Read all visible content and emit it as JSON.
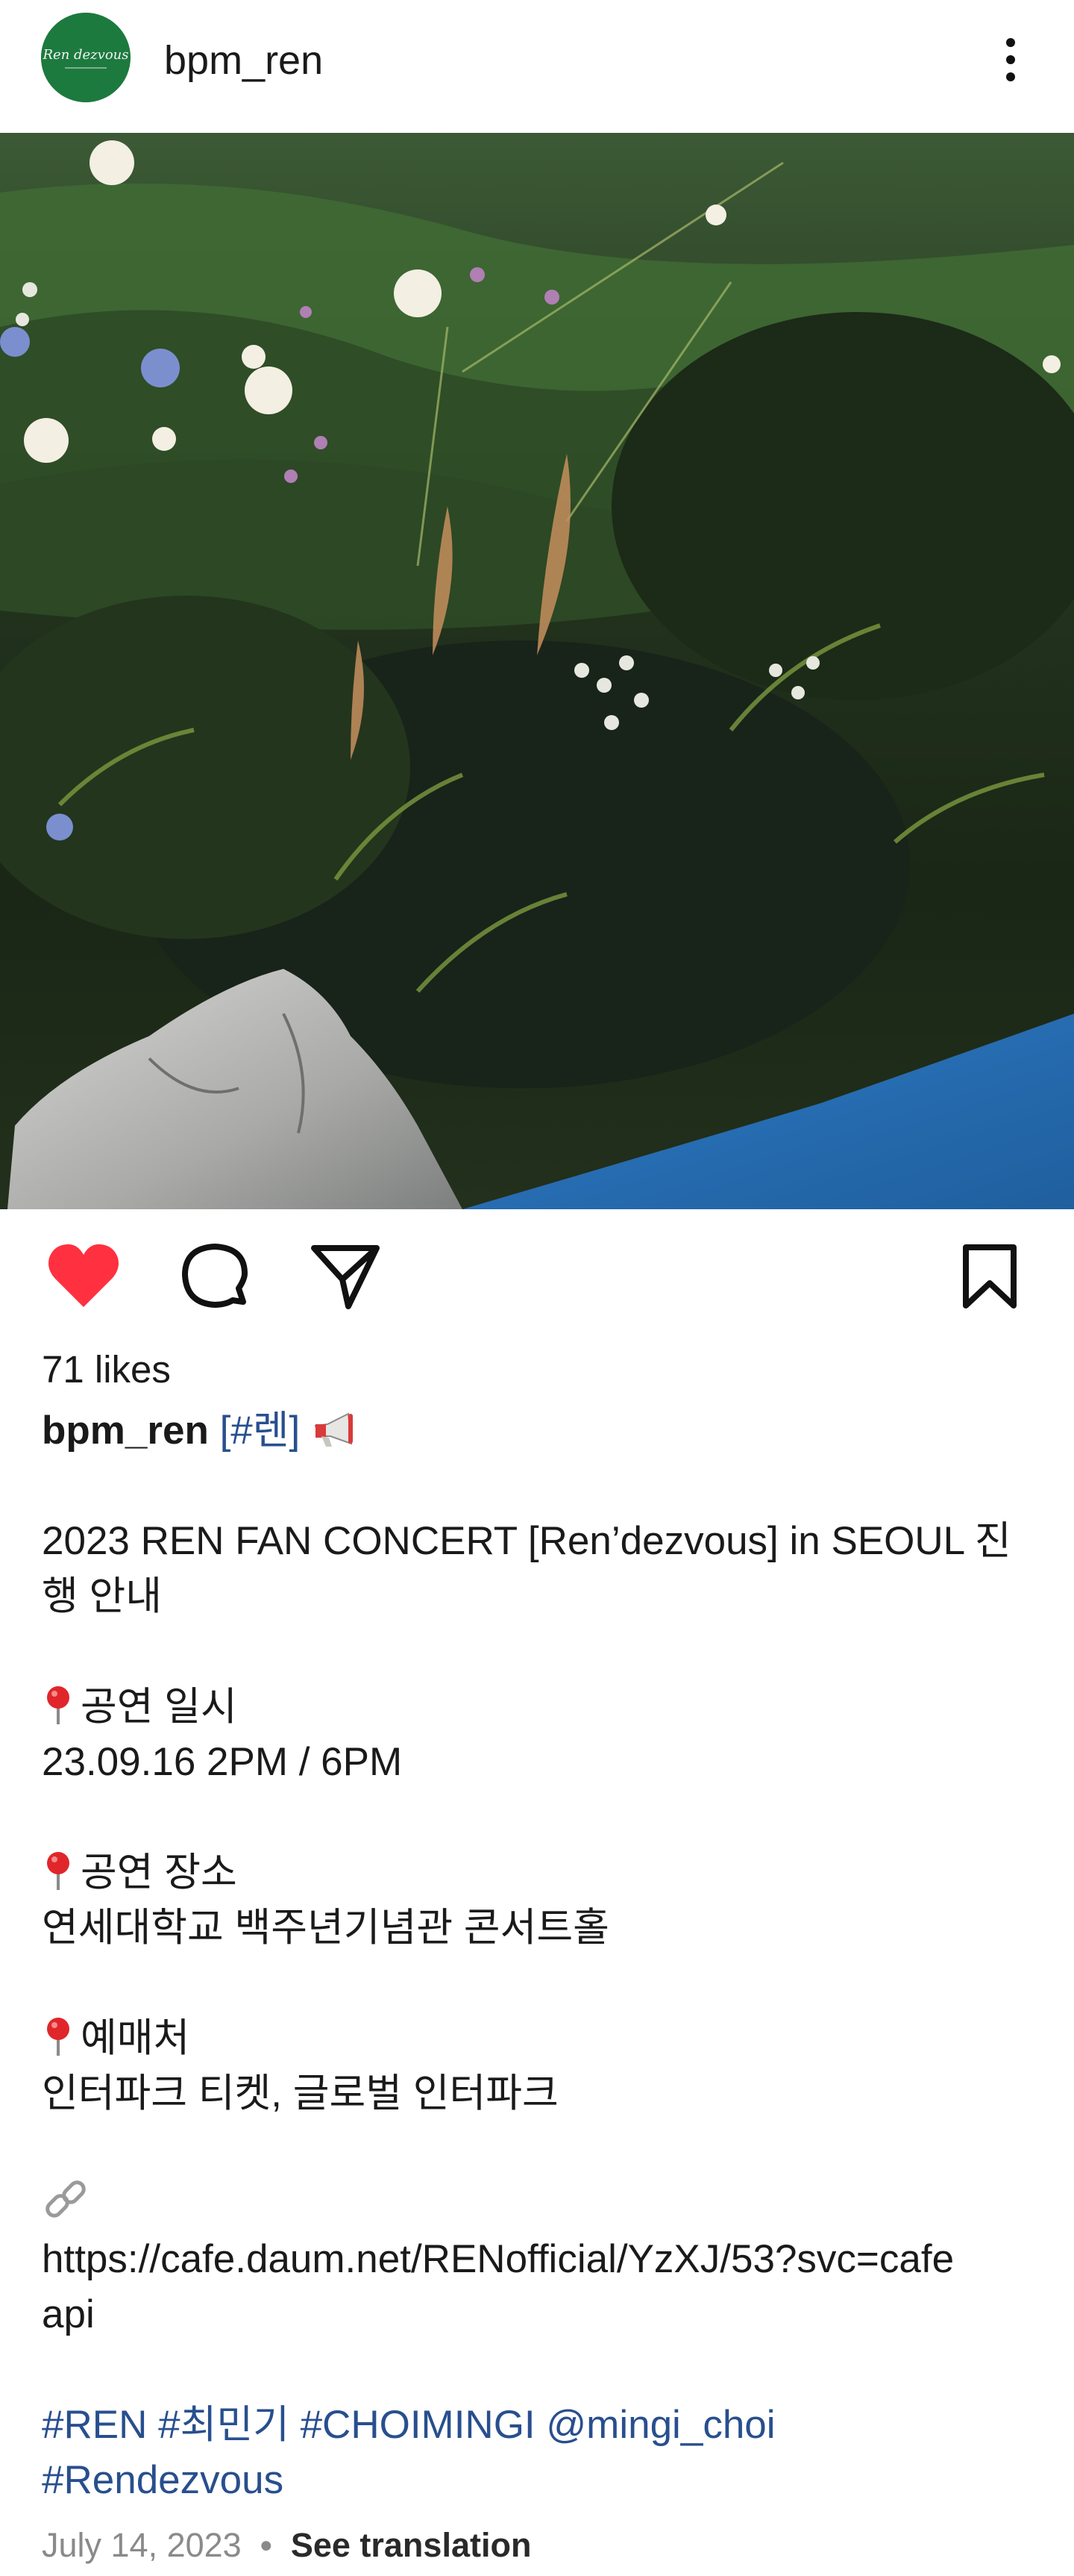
{
  "header": {
    "username": "bpm_ren",
    "avatar_text": "Ren dezvous"
  },
  "post": {
    "likes": "71 likes",
    "caption": {
      "author": "bpm_ren",
      "first_tag": "[#렌]",
      "title_line1": "2023 REN FAN CONCERT [Ren’dezvous] in SEOUL 진",
      "title_line2": "행 안내",
      "date_label": "공연 일시",
      "date_value": "23.09.16 2PM / 6PM",
      "venue_label": "공연 장소",
      "venue_value": "연세대학교 백주년기념관 콘서트홀",
      "ticket_label": "예매처",
      "ticket_value": "인터파크 티켓, 글로벌 인터파크",
      "link_line1": "https://cafe.daum.net/RENofficial/YzXJ/53?svc=cafe",
      "link_line2": "api",
      "tags_line1": "#REN #최민기 #CHOIMINGI @mingi_choi",
      "tags_line2": "#Rendezvous"
    },
    "date": "July 14, 2023",
    "see_translation": "See translation"
  },
  "icons": {
    "more": "more-vertical-icon",
    "like": "heart-filled-icon",
    "comment": "comment-icon",
    "share": "send-icon",
    "save": "bookmark-icon",
    "megaphone": "megaphone-icon",
    "pin": "round-pushpin-icon",
    "link": "link-icon"
  },
  "colors": {
    "like_red": "#ff3040",
    "link_blue": "#284f8e",
    "avatar_green": "#1c7a3e"
  }
}
